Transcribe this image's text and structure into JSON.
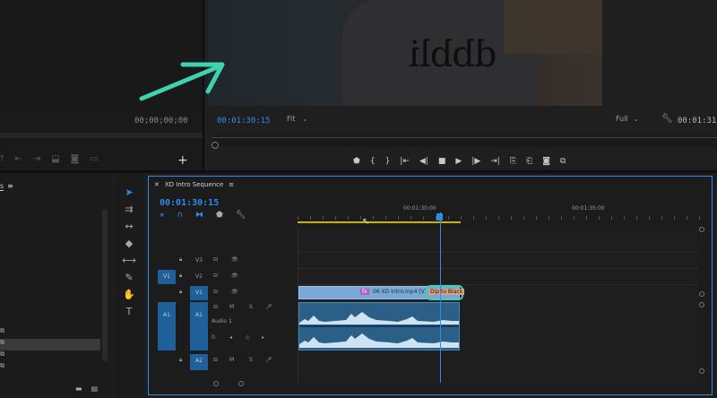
{
  "source": {
    "timecode": "00;00;00;00"
  },
  "program": {
    "timecode": "00:01:30:15",
    "fit_label": "Fit",
    "quality_label": "Full",
    "end_timecode": "00:01:31:"
  },
  "shirt_text": "dbbli",
  "timeline": {
    "tab_label": "XD Intro Sequence",
    "timecode": "00:01:30:15",
    "ruler": [
      "00:01:30:00",
      "00:01:35:00"
    ],
    "tracks": {
      "v3": "V3",
      "v2": "V2",
      "v1": "V1",
      "a1": "A1",
      "a2": "A2",
      "v1_source": "V1",
      "a1_source": "A1",
      "audio_name": "Audio 1",
      "m": "M",
      "s": "S"
    },
    "clip_label": "06 XD Intro.mp4 [V]",
    "transition_label": "Dip to Black",
    "fx_badge": "fx",
    "audio_value": "0."
  },
  "project": {
    "tab_label": "s"
  },
  "colors": {
    "accent": "#2d8ceb",
    "highlight": "#3fd1b0",
    "playhead": "#2d8ceb",
    "workarea": "#c8b400",
    "clip": "#6b9fd0"
  }
}
